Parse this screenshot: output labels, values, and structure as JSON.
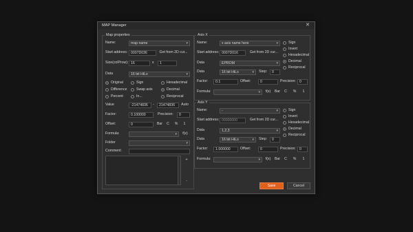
{
  "window": {
    "title": "MAP Manager",
    "close_icon": "close-icon"
  },
  "map": {
    "group_title": "Map properties",
    "name_label": "Name:",
    "name_value": "map name",
    "start_label": "Start address:",
    "start_value": "0007D036",
    "start_btn": "Get from 2D cur...",
    "size_label": "Size(colProw):",
    "size_cols": "16",
    "size_x": "x",
    "size_rows": "1",
    "data_label": "Data",
    "data_value": "16 bit HiLo",
    "opt_original": "Original",
    "opt_difference": "Difference",
    "opt_percent": "Percent",
    "opt_sign": "Sign",
    "opt_swap": "Swap axis",
    "opt_inv": "In...",
    "opt_hex": "Hexadecimal",
    "opt_dec": "Decimal",
    "opt_recip": "Reciprocal",
    "value_label": "Value",
    "value_min": "-21474836",
    "value_dash": "-",
    "value_max": "21474836",
    "auto_btn": "Auto",
    "factor_label": "Factor:",
    "factor_value": "0.100000",
    "precision_label": "Precision:",
    "precision_value": "0",
    "offset_label": "Offset:",
    "offset_value": "0",
    "btn_bar": "Bar",
    "btn_c": "C",
    "btn_pct": "%",
    "btn_1": "1",
    "formula_label": "Formula:",
    "fx": "f(x)",
    "folder_label": "Folder",
    "comment_label": "Comment:",
    "side_plus": "+",
    "side_minus": "-"
  },
  "axis_x": {
    "group_title": "Axis X",
    "name_label": "Name:",
    "name_value": "x axis name here",
    "sign": "Sign",
    "invert": "Invert",
    "hex": "Hexadecimal",
    "dec": "Decimal",
    "recip": "Reciprocal",
    "start_label": "Start address:",
    "start_value": "0007D016",
    "start_btn": "Get from 2D cur...",
    "data_label": "Data",
    "data_value": "EPROM",
    "data2_label": "Data",
    "data2_value": "16 bit HiLo",
    "step_label": "Step:",
    "step_value": "0",
    "factor_label": "Factor:",
    "factor_value": "0.1",
    "offset_label": "Offset:",
    "offset_value": "0",
    "precision_label": "Precision:",
    "precision_value": "0",
    "formula_label": "Formula:",
    "fx": "f(x)",
    "btn_bar": "Bar",
    "btn_c": "C",
    "btn_pct": "%",
    "btn_1": "1"
  },
  "axis_y": {
    "group_title": "Axis Y",
    "name_label": "Name:",
    "name_value": "-",
    "sign": "Sign",
    "invert": "Invert",
    "hex": "Hexadecimal",
    "dec": "Decimal",
    "recip": "Reciprocal",
    "start_label": "Start address:",
    "start_value": "00000000",
    "start_btn": "Get from 2D cur...",
    "data_label": "Data",
    "data_value": "1,2,3",
    "data2_label": "Data",
    "data2_value": "16 bit HiLo",
    "step_label": "Step:",
    "step_value": "0",
    "factor_label": "Factor:",
    "factor_value": "1.000000",
    "offset_label": "Offset:",
    "offset_value": "0",
    "precision_label": "Precision:",
    "precision_value": "0",
    "formula_label": "Formula:",
    "fx": "f(x)",
    "btn_bar": "Bar",
    "btn_c": "C",
    "btn_pct": "%",
    "btn_1": "1"
  },
  "footer": {
    "save": "Save",
    "cancel": "Cancel",
    "save_color": "#e0601e"
  }
}
